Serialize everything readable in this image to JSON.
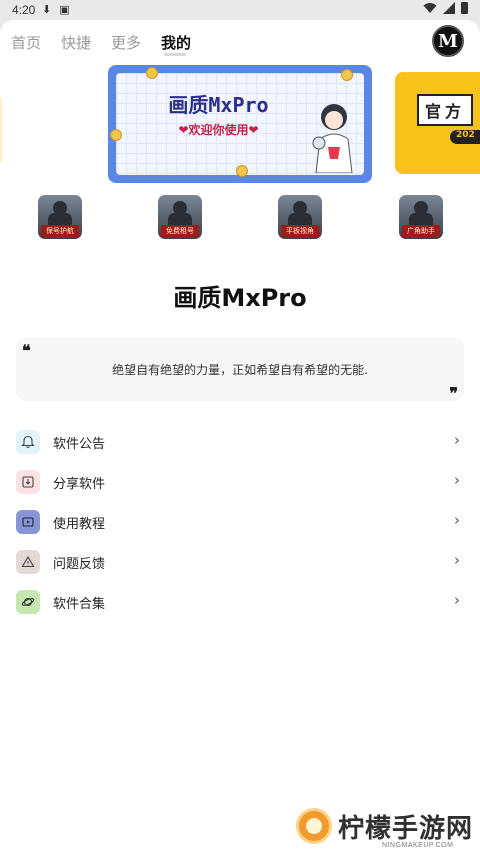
{
  "status_bar": {
    "time": "4:20"
  },
  "nav": {
    "tabs": [
      {
        "label": "首页",
        "active": false
      },
      {
        "label": "快捷",
        "active": false
      },
      {
        "label": "更多",
        "active": false
      },
      {
        "label": "我的",
        "active": true
      }
    ],
    "logo_letter": "M"
  },
  "banners": {
    "main_title": "画质MxPro",
    "main_subtitle": "❤欢迎你使用❤",
    "side_tag": "官方",
    "side_year": "202"
  },
  "apps": [
    {
      "label": "保号护航"
    },
    {
      "label": "免费租号"
    },
    {
      "label": "平板视角"
    },
    {
      "label": "广角助手"
    }
  ],
  "app_title": "画质MxPro",
  "quote": {
    "open_mark": "❝",
    "text": "绝望自有绝望的力量，正如希望自有希望的无能.",
    "close_mark": "❞"
  },
  "menu": [
    {
      "label": "软件公告",
      "icon": "bell-icon",
      "color": "#e3f3fb"
    },
    {
      "label": "分享软件",
      "icon": "download-box-icon",
      "color": "#fde0e3"
    },
    {
      "label": "使用教程",
      "icon": "video-icon",
      "color": "#8a95d9"
    },
    {
      "label": "问题反馈",
      "icon": "warning-icon",
      "color": "#e7d8d8"
    },
    {
      "label": "软件合集",
      "icon": "planet-icon",
      "color": "#c6e7b0"
    }
  ],
  "watermark": {
    "text": "柠檬手游网",
    "url": "NINGMAKEUP.COM"
  }
}
